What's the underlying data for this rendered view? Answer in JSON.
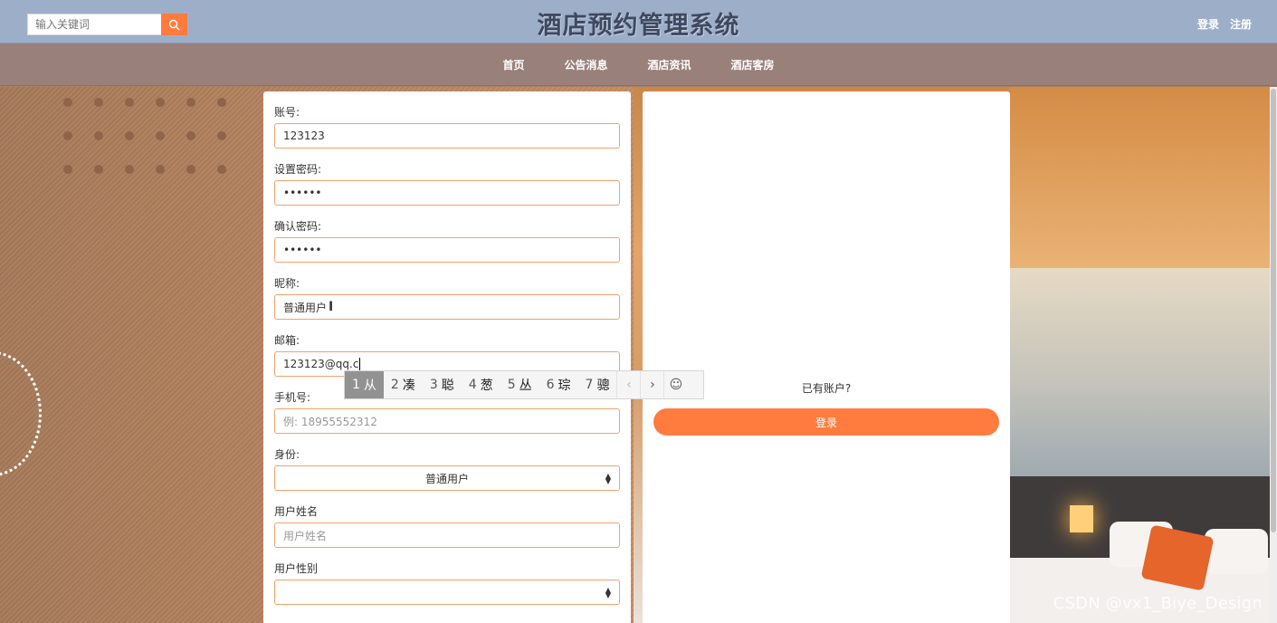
{
  "header": {
    "search_placeholder": "输入关键词",
    "site_title": "酒店预约管理系统",
    "login_label": "登录",
    "register_label": "注册",
    "accent_color": "#ff7c3e"
  },
  "nav": {
    "items": [
      {
        "label": "首页"
      },
      {
        "label": "公告消息"
      },
      {
        "label": "酒店资讯"
      },
      {
        "label": "酒店客房"
      }
    ]
  },
  "form": {
    "account": {
      "label": "账号:",
      "value": "123123"
    },
    "password": {
      "label": "设置密码:",
      "value": "••••••"
    },
    "confirm_password": {
      "label": "确认密码:",
      "value": "••••••"
    },
    "nickname": {
      "label": "昵称:",
      "value": "普通用户"
    },
    "email": {
      "label": "邮箱:",
      "value": "123123@qq.c"
    },
    "phone": {
      "label": "手机号:",
      "placeholder": "例: 18955552312"
    },
    "identity": {
      "label": "身份:",
      "value": "普通用户"
    },
    "real_name": {
      "label": "用户姓名",
      "placeholder": "用户姓名"
    },
    "gender": {
      "label": "用户性别",
      "value": ""
    }
  },
  "ime": {
    "candidates": [
      {
        "num": "1",
        "text": "从"
      },
      {
        "num": "2",
        "text": "凑"
      },
      {
        "num": "3",
        "text": "聪"
      },
      {
        "num": "4",
        "text": "葱"
      },
      {
        "num": "5",
        "text": "丛"
      },
      {
        "num": "6",
        "text": "琮"
      },
      {
        "num": "7",
        "text": "骢"
      }
    ],
    "prev": "‹",
    "next": "›",
    "emoji": "☺"
  },
  "side": {
    "have_account": "已有账户?",
    "login_button": "登录"
  },
  "watermark": "CSDN @vx1_Biye_Design"
}
